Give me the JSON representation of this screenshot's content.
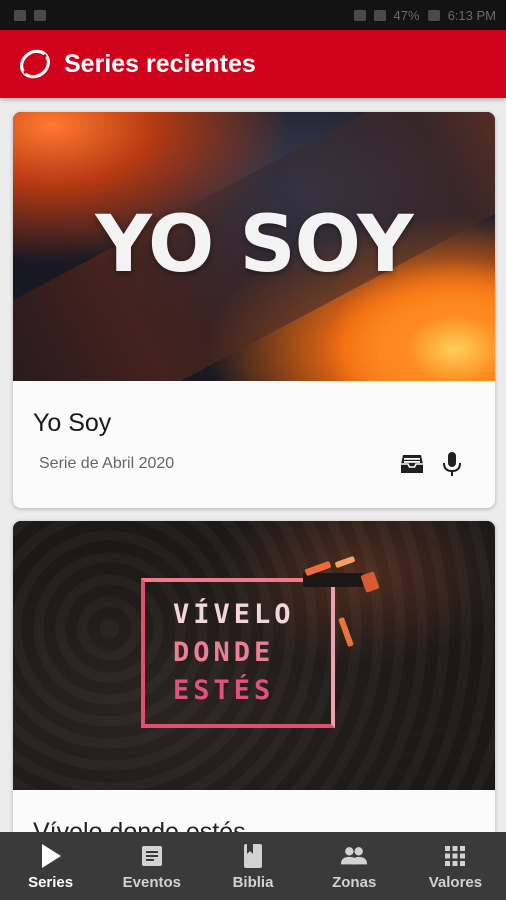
{
  "status_bar": {
    "battery": "47%",
    "time": "6:13 PM"
  },
  "header": {
    "title": "Series recientes",
    "brand_color": "#d0021b"
  },
  "cards": [
    {
      "image_text": "YO SOY",
      "title": "Yo Soy",
      "subtitle": "Serie de Abril 2020",
      "actions": [
        "inbox-icon",
        "microphone-icon"
      ]
    },
    {
      "image_lines": [
        "VÍVELO",
        "DONDE",
        "ESTÉS"
      ],
      "title": "Vívelo donde estés",
      "subtitle": ""
    }
  ],
  "bottom_nav": {
    "items": [
      {
        "label": "Series",
        "icon": "play-icon",
        "active": true
      },
      {
        "label": "Eventos",
        "icon": "article-icon",
        "active": false
      },
      {
        "label": "Biblia",
        "icon": "book-icon",
        "active": false
      },
      {
        "label": "Zonas",
        "icon": "people-icon",
        "active": false
      },
      {
        "label": "Valores",
        "icon": "grid-icon",
        "active": false
      }
    ]
  }
}
